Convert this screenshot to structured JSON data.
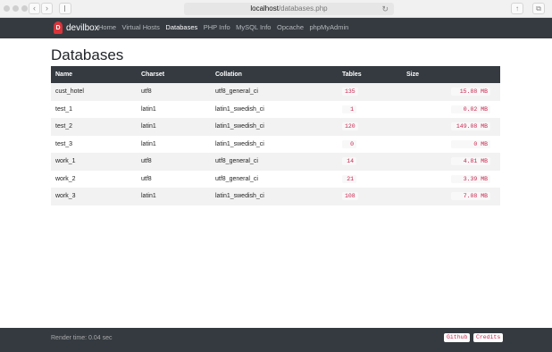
{
  "browser": {
    "url_host": "localhost",
    "url_path": "/databases.php"
  },
  "brand": {
    "name": "devilbox",
    "logo_letter": "D",
    "logo_color": "#d9343a"
  },
  "nav": {
    "items": [
      {
        "label": "Home",
        "active": false
      },
      {
        "label": "Virtual Hosts",
        "active": false
      },
      {
        "label": "Databases",
        "active": true
      },
      {
        "label": "PHP Info",
        "active": false
      },
      {
        "label": "MySQL Info",
        "active": false
      },
      {
        "label": "Opcache",
        "active": false
      },
      {
        "label": "phpMyAdmin",
        "active": false
      }
    ]
  },
  "page": {
    "title": "Databases"
  },
  "table": {
    "headers": [
      "Name",
      "Charset",
      "Collation",
      "Tables",
      "Size"
    ],
    "rows": [
      {
        "name": "cust_hotel",
        "charset": "utf8",
        "collation": "utf8_general_ci",
        "tables": "135",
        "size": "15.88 MB"
      },
      {
        "name": "test_1",
        "charset": "latin1",
        "collation": "latin1_swedish_ci",
        "tables": "1",
        "size": "0.02 MB"
      },
      {
        "name": "test_2",
        "charset": "latin1",
        "collation": "latin1_swedish_ci",
        "tables": "120",
        "size": "149.08 MB"
      },
      {
        "name": "test_3",
        "charset": "latin1",
        "collation": "latin1_swedish_ci",
        "tables": "0",
        "size": "0   MB"
      },
      {
        "name": "work_1",
        "charset": "utf8",
        "collation": "utf8_general_ci",
        "tables": "14",
        "size": "4.81 MB"
      },
      {
        "name": "work_2",
        "charset": "utf8",
        "collation": "utf8_general_ci",
        "tables": "21",
        "size": "3.39 MB"
      },
      {
        "name": "work_3",
        "charset": "latin1",
        "collation": "latin1_swedish_ci",
        "tables": "108",
        "size": "7.08 MB"
      }
    ]
  },
  "footer": {
    "render_time": "Render time: 0.04 sec",
    "github_label": "Github",
    "credits_label": "Credits"
  }
}
